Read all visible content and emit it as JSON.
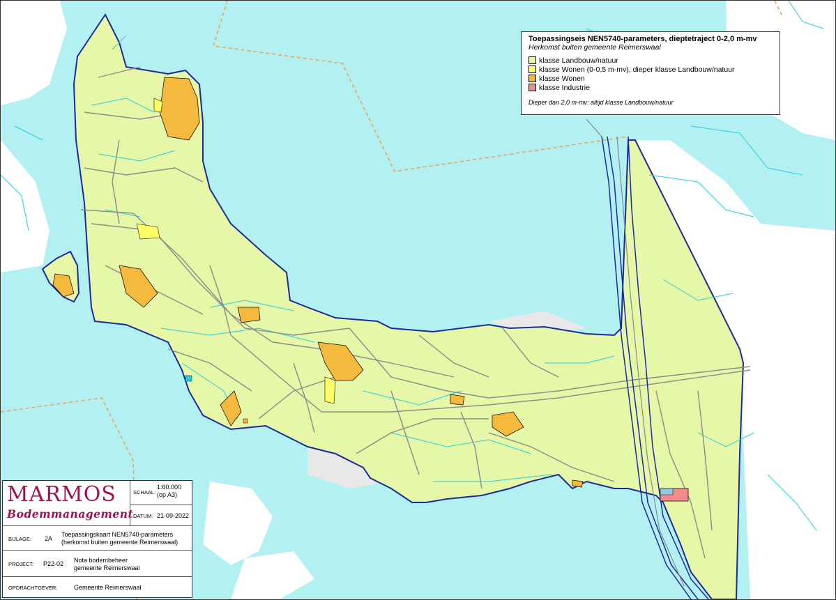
{
  "legend": {
    "title": "Toepassingseis NEN5740-parameters, dieptetraject 0-2,0 m-mv",
    "subtitle": "Herkomst buiten gemeente Reimerswaal",
    "items": [
      {
        "label": "klasse Landbouw/natuur",
        "color": "#e6f7a8"
      },
      {
        "label": "klasse Wonen (0-0,5 m-mv), dieper klasse Landbouw/natuur",
        "color": "#ffff66"
      },
      {
        "label": "klasse Wonen",
        "color": "#f5b93d"
      },
      {
        "label": "klasse Industrie",
        "color": "#f28b8b"
      }
    ],
    "note": "Dieper dan 2,0 m-mv: altijd klasse Landbouw/natuur"
  },
  "titleblock": {
    "logo_line1": "MARMOS",
    "logo_line2": "Bodemmanagement",
    "schaal_label": "SCHAAL:",
    "schaal_value": "1:60.000",
    "schaal_note": "(op A3)",
    "datum_label": "DATUM:",
    "datum_value": "21-09-2022",
    "bijlage_label": "BIJLAGE:",
    "bijlage_value": "2A",
    "bijlage_desc1": "Toepassingskaart NEN5740-parameters",
    "bijlage_desc2": "(herkomst buiten gemeente Reimerswaal)",
    "project_label": "PROJECT:",
    "project_value": "P22-02",
    "project_desc1": "Nota bodembeheer",
    "project_desc2": "gemeente Reimerswaal",
    "opdracht_label": "OPDRACHTGEVER:",
    "opdracht_value": "Gemeente Reimerswaal"
  },
  "colors": {
    "water": "#b3f0f2",
    "land": "#e6f7a8",
    "boundary": "#1a2a9c",
    "roads": "#8a8a8a",
    "ditches": "#22d0e0",
    "dashed_border": "#f0a050",
    "wonen": "#f5b93d",
    "wonen_dieper": "#ffff66",
    "industrie": "#f28b8b"
  }
}
